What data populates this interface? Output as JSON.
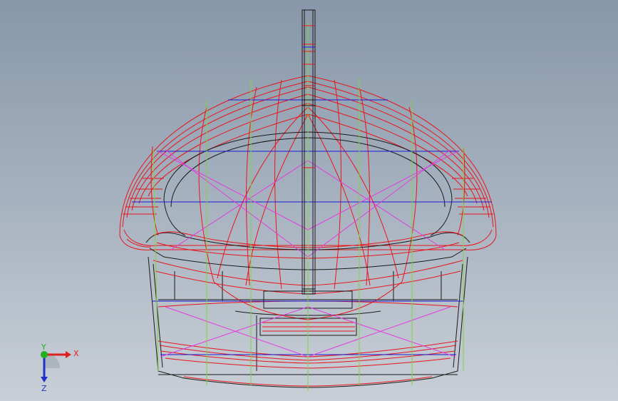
{
  "viewport": {
    "background_top": "#8797a9",
    "background_bottom": "#c9cfd7"
  },
  "model": {
    "wire_colors": {
      "edge_red": "#e8151b",
      "outline_black": "#1a1a1a",
      "section_blue": "#1c1cd8",
      "diagonal_magenta": "#e23be0",
      "guide_green": "#7fd43a"
    }
  },
  "triad": {
    "x_label": "X",
    "y_label": "Y",
    "z_label": "Z",
    "x_color": "#e02020",
    "y_color": "#20b020",
    "z_color": "#2030c8",
    "x_icon": "axis-arrow-x",
    "y_icon": "axis-origin-y",
    "z_icon": "axis-arrow-z"
  }
}
